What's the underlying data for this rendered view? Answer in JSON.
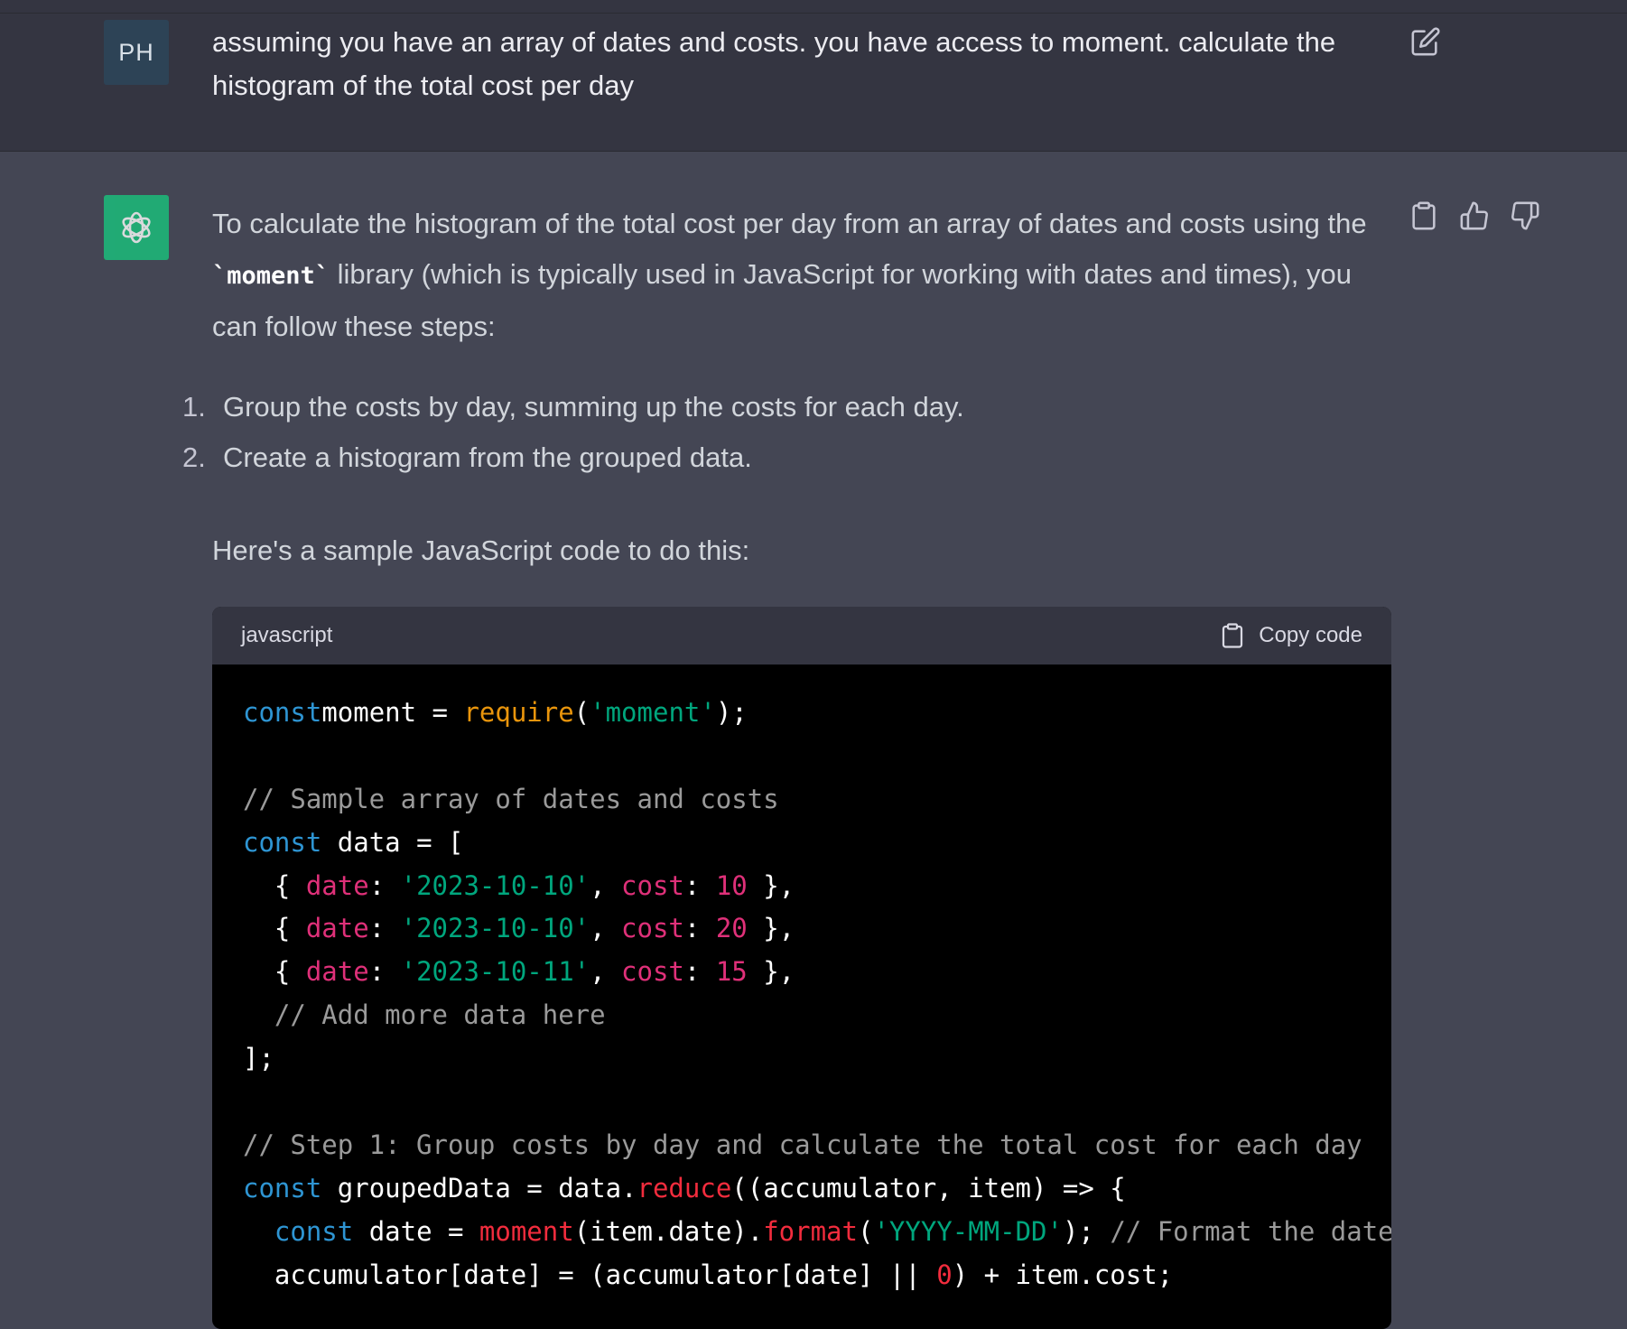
{
  "user": {
    "avatar_initials": "PH",
    "message": "assuming you have an array of dates and costs. you have access to moment. calculate the histogram of the total cost per day",
    "edit_icon": "edit-icon"
  },
  "assistant": {
    "intro_part1": "To calculate the histogram of the total cost per day from an array of dates and costs using the ",
    "intro_code": "`moment`",
    "intro_part2": " library (which is typically used in JavaScript for working with dates and times), you can follow these steps:",
    "steps": [
      {
        "num": "1.",
        "text": "Group the costs by day, summing up the costs for each day."
      },
      {
        "num": "2.",
        "text": "Create a histogram from the grouped data."
      }
    ],
    "sample_text": "Here's a sample JavaScript code to do this:",
    "actions": [
      "clipboard-icon",
      "thumbs-up-icon",
      "thumbs-down-icon"
    ]
  },
  "code_block": {
    "language": "javascript",
    "copy_label": "Copy code",
    "lines": [
      [
        [
          "kw",
          "const"
        ],
        [
          "",
          "moment = "
        ],
        [
          "req",
          "require"
        ],
        [
          "",
          "("
        ],
        [
          "str",
          "'moment'"
        ],
        [
          "",
          ");"
        ]
      ],
      [],
      [
        [
          "com",
          "// Sample array of dates and costs"
        ]
      ],
      [
        [
          "kw",
          "const"
        ],
        [
          "",
          " data = ["
        ]
      ],
      [
        [
          "",
          "  { "
        ],
        [
          "prop",
          "date"
        ],
        [
          "",
          ": "
        ],
        [
          "str",
          "'2023-10-10'"
        ],
        [
          "",
          ", "
        ],
        [
          "prop",
          "cost"
        ],
        [
          "",
          ": "
        ],
        [
          "num-lit",
          "10"
        ],
        [
          "",
          " },"
        ]
      ],
      [
        [
          "",
          "  { "
        ],
        [
          "prop",
          "date"
        ],
        [
          "",
          ": "
        ],
        [
          "str",
          "'2023-10-10'"
        ],
        [
          "",
          ", "
        ],
        [
          "prop",
          "cost"
        ],
        [
          "",
          ": "
        ],
        [
          "num-lit",
          "20"
        ],
        [
          "",
          " },"
        ]
      ],
      [
        [
          "",
          "  { "
        ],
        [
          "prop",
          "date"
        ],
        [
          "",
          ": "
        ],
        [
          "str",
          "'2023-10-11'"
        ],
        [
          "",
          ", "
        ],
        [
          "prop",
          "cost"
        ],
        [
          "",
          ": "
        ],
        [
          "num-lit",
          "15"
        ],
        [
          "",
          " },"
        ]
      ],
      [
        [
          "com",
          "  // Add more data here"
        ]
      ],
      [
        [
          "",
          "];"
        ]
      ],
      [],
      [
        [
          "com",
          "// Step 1: Group costs by day and calculate the total cost for each day"
        ]
      ],
      [
        [
          "kw",
          "const"
        ],
        [
          "",
          " groupedData = data."
        ],
        [
          "fn",
          "reduce"
        ],
        [
          "",
          "((accumulator, item) => {"
        ]
      ],
      [
        [
          "",
          "  "
        ],
        [
          "kw",
          "const"
        ],
        [
          "",
          " date = "
        ],
        [
          "fn",
          "moment"
        ],
        [
          "",
          "(item.date)."
        ],
        [
          "fn",
          "format"
        ],
        [
          "",
          "("
        ],
        [
          "str",
          "'YYYY-MM-DD'"
        ],
        [
          "",
          "); "
        ],
        [
          "com",
          "// Format the date to"
        ]
      ],
      [
        [
          "",
          "  accumulator[date] = (accumulator[date] || "
        ],
        [
          "fn",
          "0"
        ],
        [
          "",
          ") + item.cost;"
        ]
      ]
    ]
  },
  "colors": {
    "page_bg": "#444654",
    "user_bg": "#343541",
    "assistant_avatar": "#19c37d",
    "code_bg": "#000000"
  }
}
